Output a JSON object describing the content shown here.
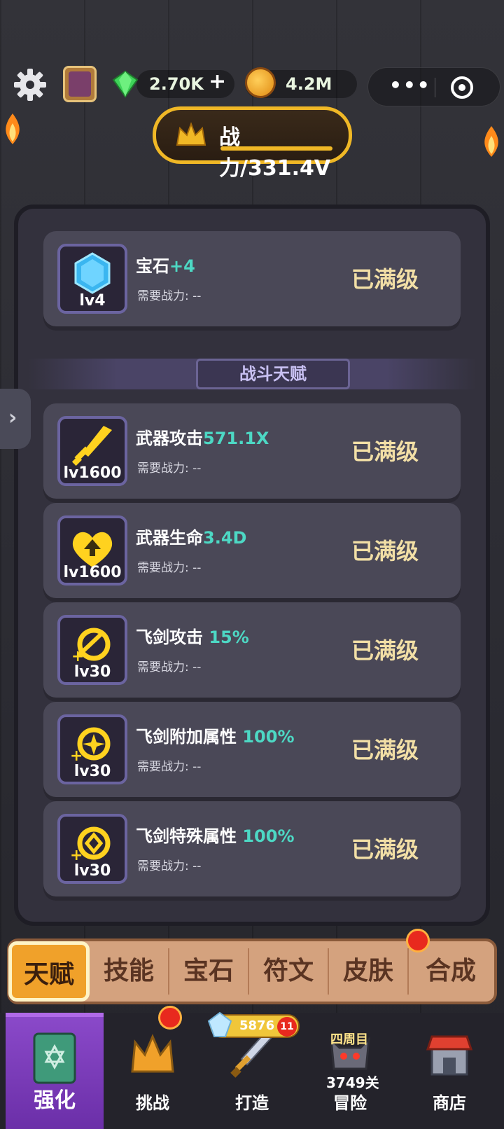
{
  "topbar": {
    "gems": "2.70K",
    "gems_plus": "+",
    "coins": "4.2M"
  },
  "power": {
    "text": "战力/331.4V"
  },
  "upgrades": [
    {
      "name": "宝石",
      "value": "+4",
      "level": "lv4",
      "requirement": "需要战力: --",
      "status": "已满级",
      "icon": "gem-icon"
    }
  ],
  "section": {
    "title": "战斗天赋"
  },
  "talents": [
    {
      "name": "武器攻击",
      "value": "571.1X",
      "level": "lv1600",
      "requirement": "需要战力: --",
      "status": "已满级",
      "icon": "sword-icon"
    },
    {
      "name": "武器生命",
      "value": "3.4D",
      "level": "lv1600",
      "requirement": "需要战力: --",
      "status": "已满级",
      "icon": "heart-icon"
    },
    {
      "name": "飞剑攻击",
      "value": " 15%",
      "level": "lv30",
      "requirement": "需要战力: --",
      "status": "已满级",
      "icon": "flying-sword-attack-icon"
    },
    {
      "name": "飞剑附加属性",
      "value": " 100%",
      "level": "lv30",
      "requirement": "需要战力: --",
      "status": "已满级",
      "icon": "flying-sword-bonus-icon"
    },
    {
      "name": "飞剑特殊属性",
      "value": " 100%",
      "level": "lv30",
      "requirement": "需要战力: --",
      "status": "已满级",
      "icon": "flying-sword-special-icon"
    }
  ],
  "tabs": [
    "天赋",
    "技能",
    "宝石",
    "符文",
    "皮肤",
    "合成"
  ],
  "nav": {
    "items": [
      "强化",
      "挑战",
      "打造",
      "冒险",
      "商店"
    ],
    "crystal_count": "5876",
    "crystal_badge": "11",
    "adventure_week": "四周目",
    "adventure_stage": "3749关"
  },
  "colors": {
    "accent_gold": "#f0b826",
    "value_teal": "#4dd8c4",
    "nav_active": "#8a49c9"
  }
}
